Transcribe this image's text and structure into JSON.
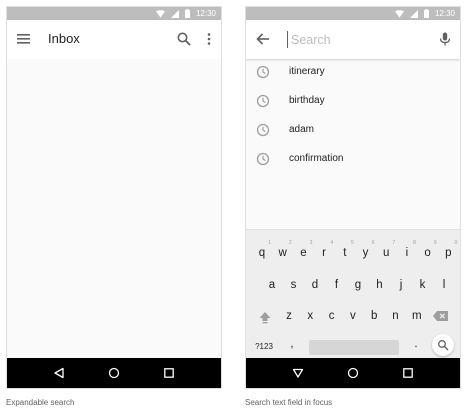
{
  "status_bar": {
    "time": "12:30"
  },
  "left_screen": {
    "toolbar": {
      "menu_icon": "menu-icon",
      "title": "Inbox",
      "search_icon": "search-icon",
      "more_icon": "more-vert-icon"
    },
    "caption": "Expandable search"
  },
  "right_screen": {
    "search": {
      "back_icon": "arrow-back-icon",
      "placeholder": "Search",
      "value": "",
      "mic_icon": "mic-icon"
    },
    "suggestions": [
      {
        "label": "itinerary",
        "icon": "history-icon"
      },
      {
        "label": "birthday",
        "icon": "history-icon"
      },
      {
        "label": "adam",
        "icon": "history-icon"
      },
      {
        "label": "confirmation",
        "icon": "history-icon"
      }
    ],
    "keyboard": {
      "row1": [
        "q",
        "w",
        "e",
        "r",
        "t",
        "y",
        "u",
        "i",
        "o",
        "p"
      ],
      "row1_hints": [
        "1",
        "2",
        "3",
        "4",
        "5",
        "6",
        "7",
        "8",
        "9",
        "0"
      ],
      "row2": [
        "a",
        "s",
        "d",
        "f",
        "g",
        "h",
        "j",
        "k",
        "l"
      ],
      "row3": [
        "z",
        "x",
        "c",
        "v",
        "b",
        "n",
        "m"
      ],
      "symbols_label": "?123",
      "comma": ",",
      "period": ".",
      "shift_icon": "shift-icon",
      "backspace_icon": "backspace-icon",
      "search_key_icon": "search-icon"
    },
    "caption": "Search text field in focus"
  },
  "nav_bar": {
    "back_icon": "nav-back-icon",
    "home_icon": "nav-home-icon",
    "recents_icon": "nav-recents-icon"
  },
  "colors": {
    "status_bar": "#bdbdbd",
    "nav_bar": "#000000",
    "keyboard_bg": "#eeeeee",
    "screen_bg": "#fafafa"
  }
}
